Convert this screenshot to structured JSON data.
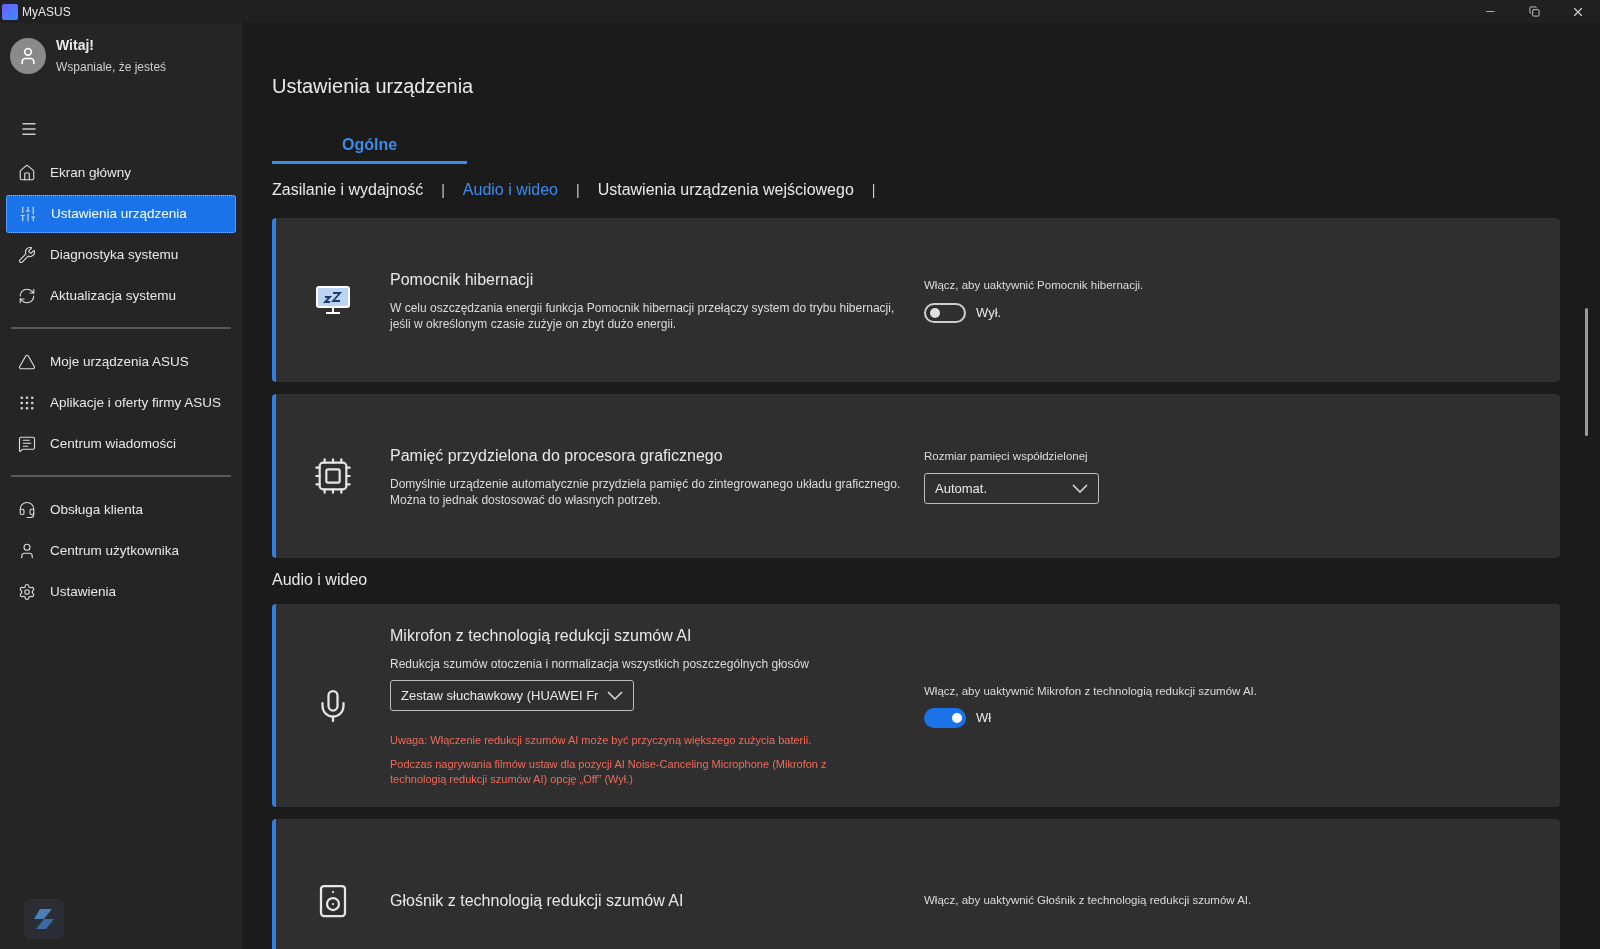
{
  "window": {
    "title": "MyASUS"
  },
  "user": {
    "greeting": "Witaj!",
    "subtitle": "Wspaniale, że jesteś"
  },
  "sidebar": {
    "groups": [
      [
        {
          "label": "Ekran główny",
          "selected": false
        },
        {
          "label": "Ustawienia urządzenia",
          "selected": true
        },
        {
          "label": "Diagnostyka systemu",
          "selected": false
        },
        {
          "label": "Aktualizacja systemu",
          "selected": false
        }
      ],
      [
        {
          "label": "Moje urządzenia ASUS",
          "selected": false
        },
        {
          "label": "Aplikacje i oferty firmy ASUS",
          "selected": false
        },
        {
          "label": "Centrum wiadomości",
          "selected": false
        }
      ],
      [
        {
          "label": "Obsługa klienta",
          "selected": false
        },
        {
          "label": "Centrum użytkownika",
          "selected": false
        },
        {
          "label": "Ustawienia",
          "selected": false
        }
      ]
    ]
  },
  "page": {
    "title": "Ustawienia urządzenia",
    "tabs": [
      {
        "label": "Ogólne",
        "selected": true
      }
    ],
    "subnav": [
      {
        "label": "Zasilanie i wydajność",
        "selected": false
      },
      {
        "label": "Audio i wideo",
        "selected": true
      },
      {
        "label": "Ustawienia urządzenia wejściowego",
        "selected": false
      }
    ],
    "separator": "|",
    "sections": [
      {
        "cards": [
          {
            "title": "Pomocnik hibernacji",
            "description": "W celu oszczędzania energii funkcja Pomocnik hibernacji przełączy system do trybu hibernacji, jeśli w określonym czasie zużyje on zbyt dużo energii.",
            "control": {
              "kind": "toggle",
              "label": "Włącz, aby uaktywnić Pomocnik hibernacji.",
              "on": false,
              "state_label": "Wył."
            }
          },
          {
            "title": "Pamięć przydzielona do procesora graficznego",
            "description": "Domyślnie urządzenie automatycznie przydziela pamięć do zintegrowanego układu graficznego. Można to jednak dostosować do własnych potrzeb.",
            "control": {
              "kind": "select",
              "label": "Rozmiar pamięci współdzielonej",
              "value": "Automat."
            }
          }
        ]
      },
      {
        "heading": "Audio i wideo",
        "cards": [
          {
            "title": "Mikrofon z technologią redukcji szumów AI",
            "description": "Redukcja szumów otoczenia i normalizacja wszystkich poszczególnych głosów",
            "device": "Zestaw słuchawkowy (HUAWEI Fr",
            "warnings": [
              "Uwaga: Włączenie redukcji szumów AI może być przyczyną większego zużycia baterii.",
              "Podczas nagrywania filmów ustaw dla pozycji AI Noise-Canceling Microphone (Mikrofon z technologią redukcji szumów AI) opcję „Off” (Wył.)"
            ],
            "control": {
              "kind": "toggle",
              "label": "Włącz, aby uaktywnić Mikrofon z technologią redukcji szumów AI.",
              "on": true,
              "state_label": "Wł"
            }
          },
          {
            "title": "Głośnik z technologią redukcji szumów AI",
            "control": {
              "kind": "caption",
              "label": "Włącz, aby uaktywnić Głośnik z technologią redukcji szumów AI."
            }
          }
        ]
      }
    ]
  }
}
